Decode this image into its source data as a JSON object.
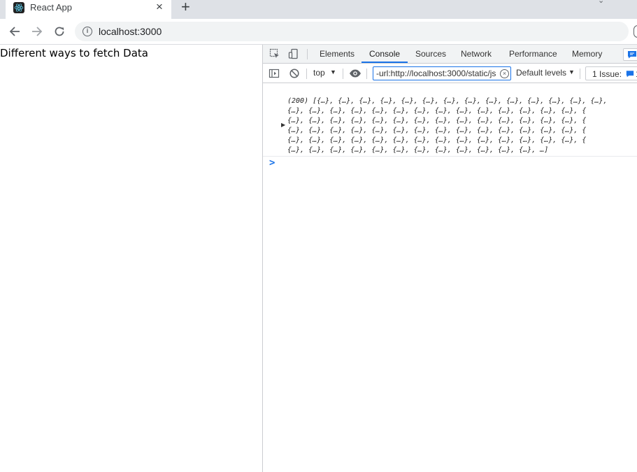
{
  "browser": {
    "tab": {
      "title": "React App",
      "close_icon": "close-icon",
      "favicon": "react-logo-icon"
    },
    "new_tab_symbol": "+",
    "address": {
      "url": "localhost:3000",
      "info_symbol": "i"
    }
  },
  "page": {
    "heading": "Different ways to fetch Data"
  },
  "devtools": {
    "tabs": [
      "Elements",
      "Console",
      "Sources",
      "Network",
      "Performance",
      "Memory"
    ],
    "active_tab": "Console",
    "console_bar": {
      "context": "top",
      "filter_value": "-url:http://localhost:3000/static/js",
      "levels": "Default levels",
      "issues": "1 Issue: ",
      "issues_count": "1"
    },
    "log": {
      "lines": [
        "(200) [{…}, {…}, {…}, {…}, {…}, {…}, {…}, {…}, {…}, {…}, {…}, {…}, {…}, {…},",
        "{…}, {…}, {…}, {…}, {…}, {…}, {…}, {…}, {…}, {…}, {…}, {…}, {…}, {…}, {",
        "{…}, {…}, {…}, {…}, {…}, {…}, {…}, {…}, {…}, {…}, {…}, {…}, {…}, {…}, {",
        "{…}, {…}, {…}, {…}, {…}, {…}, {…}, {…}, {…}, {…}, {…}, {…}, {…}, {…}, {",
        "{…}, {…}, {…}, {…}, {…}, {…}, {…}, {…}, {…}, {…}, {…}, {…}, {…}, {…}, {",
        "{…}, {…}, {…}, {…}, {…}, {…}, {…}, {…}, {…}, {…}, {…}, {…}, …]"
      ]
    },
    "prompt_symbol": ">"
  },
  "colors": {
    "accent": "#1a73e8",
    "tabstrip": "#dee1e6",
    "devtools_bar": "#f1f3f4"
  }
}
